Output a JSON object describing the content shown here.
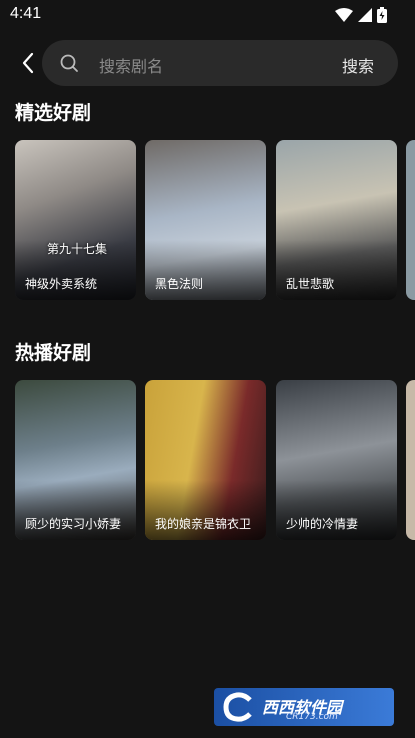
{
  "status_bar": {
    "time": "4:41",
    "icons": [
      "wifi-icon",
      "signal-icon",
      "battery-icon"
    ]
  },
  "search": {
    "placeholder": "搜索剧名",
    "button_label": "搜索"
  },
  "sections": [
    {
      "title": "精选好剧",
      "cards": [
        {
          "title": "神级外卖系统",
          "overlay": "第九十七集"
        },
        {
          "title": "黑色法则"
        },
        {
          "title": "乱世悲歌"
        }
      ]
    },
    {
      "title": "热播好剧",
      "cards": [
        {
          "title": "顾少的实习小娇妻"
        },
        {
          "title": "我的娘亲是锦衣卫"
        },
        {
          "title": "少帅的冷情妻"
        }
      ]
    }
  ],
  "watermark": {
    "text": "西西软件园",
    "sub": "CR173.com"
  }
}
